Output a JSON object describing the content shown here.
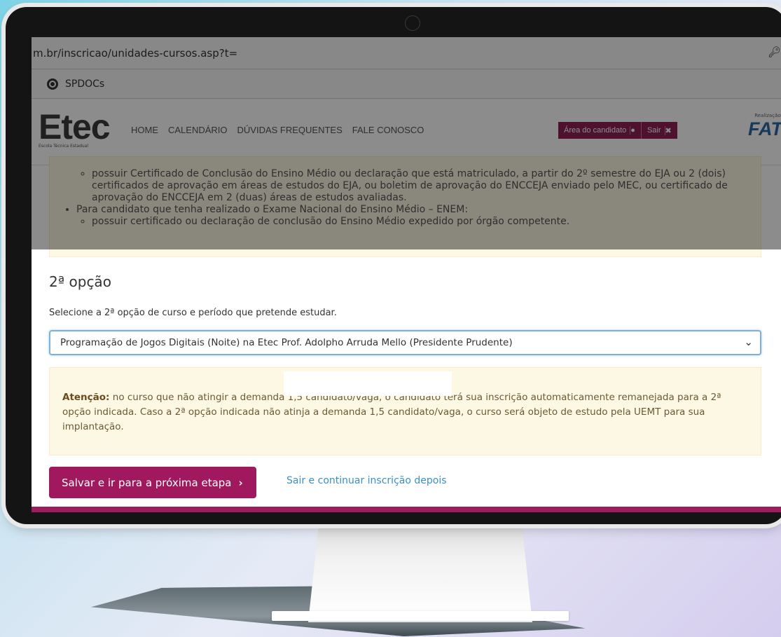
{
  "browser": {
    "url": "m.br/inscricao/unidades-cursos.asp?t=",
    "bookmark": "SPDOCs"
  },
  "header": {
    "logo_big": "Etec",
    "logo_small": "Escola Técnica Estadual",
    "nav": [
      "HOME",
      "CALENDÁRIO",
      "DÚVIDAS FREQUENTES",
      "FALE CONOSCO"
    ],
    "area_label": "Área do candidato",
    "sair_label": "Sair",
    "realizacao": "Realização:",
    "fat_logo": "FAT"
  },
  "requirements": {
    "sub1": "possuir Certificado de Conclusão do Ensino Médio ou declaração que está matriculado, a partir do 2º semestre do EJA ou 2 (dois) certificados de aprovação em áreas de estudos do EJA, ou boletim de aprovação do ENCCEJA enviado pelo MEC, ou certificado de aprovação do ENCCEJA em 2 (duas) áreas de estudos avaliadas.",
    "item2": "Para candidato que tenha realizado o Exame Nacional do Ensino Médio – ENEM:",
    "sub2": "possuir certificado ou declaração de conclusão do Ensino Médio expedido por órgão competente."
  },
  "option2": {
    "title": "2ª opção",
    "label": "Selecione a 2ª opção de curso e período que pretende estudar.",
    "selected": "Programação de Jogos Digitais (Noite) na Etec Prof. Adolpho Arruda Mello (Presidente Prudente)"
  },
  "attention": {
    "bold": "Atenção:",
    "text": " no curso que não atingir a demanda 1,5 candidato/vaga, o candidato terá sua inscrição automaticamente remanejada para a 2ª opção indicada. Caso a 2ª opção indicada não atinja a demanda 1,5 candidato/vaga, o curso será objeto de estudo pela UEMT para sua implantação."
  },
  "actions": {
    "save": "Salvar e ir para a próxima etapa",
    "exit": "Sair e continuar inscrição depois"
  },
  "colors": {
    "brand": "#a0195f",
    "link": "#3a8fc6",
    "warning_bg": "#fcf8e3"
  }
}
